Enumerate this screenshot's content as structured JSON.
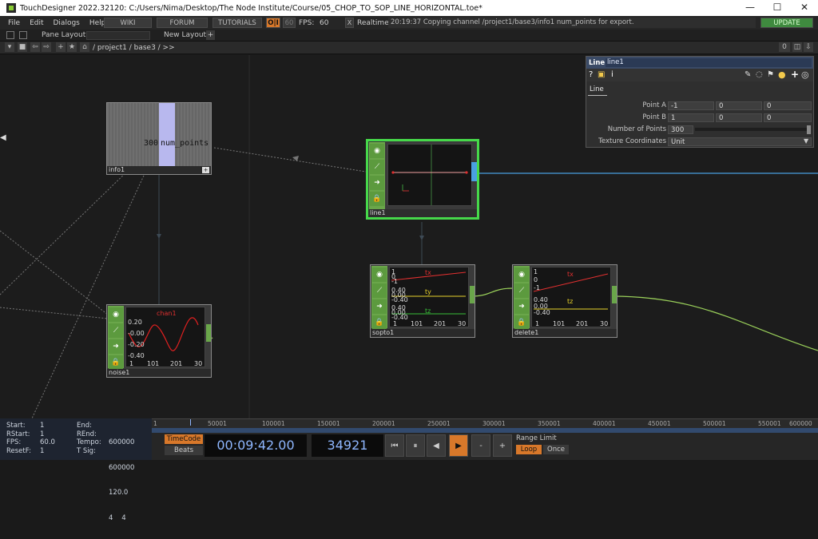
{
  "window": {
    "title": "TouchDesigner 2022.32120: C:/Users/Nima/Desktop/The Node Institute/Course/05_CHOP_TO_SOP_LINE_HORIZONTAL.toe*",
    "minimize": "—",
    "maximize": "☐",
    "close": "✕"
  },
  "menubar": {
    "items": [
      "File",
      "Edit",
      "Dialogs",
      "Help"
    ],
    "wiki": "WIKI",
    "forum": "FORUM",
    "tutorials": "TUTORIALS",
    "perf_badge": "O|I",
    "fps_value_box": "60",
    "fps_label": "FPS:",
    "fps_value": "60",
    "realtime_check": "X",
    "realtime_label": "Realtime",
    "status": "20:19:37 Copying channel /project1/base3/info1 num_points for export.",
    "update": "UPDATE"
  },
  "panebar": {
    "pane_layout": "Pane Layout",
    "new_layout": "New Layout",
    "new_layout_plus": "+"
  },
  "pathbar": {
    "path": "/ project1 / base3 / >>",
    "pane_index": "0"
  },
  "nodes": {
    "info1": {
      "label": "info1",
      "value": "300",
      "channel": "num_points"
    },
    "line1": {
      "label": "line1"
    },
    "noise1": {
      "label": "noise1",
      "channel": "chan1",
      "y_ticks": [
        "0.20",
        "-0.00",
        "-0.20",
        "-0.40"
      ],
      "x_ticks": [
        "1",
        "101",
        "201",
        "30"
      ]
    },
    "sopto1": {
      "label": "sopto1",
      "channels": [
        "tx",
        "ty",
        "tz"
      ],
      "ticks_a": [
        "1",
        "0",
        "-1"
      ],
      "ticks_b": [
        "0.40",
        "0.00",
        "-0.40"
      ],
      "ticks_c": [
        "0.40",
        "0.00",
        "-0.40"
      ],
      "x_ticks": [
        "1",
        "101",
        "201",
        "30"
      ]
    },
    "delete1": {
      "label": "delete1",
      "channels": [
        "tx",
        "tz"
      ],
      "ticks_a": [
        "1",
        "0",
        "-1"
      ],
      "ticks_b": [
        "0.40",
        "0.00",
        "-0.40"
      ],
      "x_ticks": [
        "1",
        "101",
        "201",
        "30"
      ]
    }
  },
  "params": {
    "op_type": "Line",
    "op_name": "line1",
    "tab": "Line",
    "rows": [
      {
        "label": "Point A",
        "values": [
          "-1",
          "0",
          "0"
        ]
      },
      {
        "label": "Point B",
        "values": [
          "1",
          "0",
          "0"
        ]
      },
      {
        "label": "Number of Points",
        "values": [
          "300"
        ]
      },
      {
        "label": "Texture Coordinates",
        "values": [
          "Unit"
        ]
      }
    ]
  },
  "timeline": {
    "ticks": [
      "1",
      "50001",
      "100001",
      "150001",
      "200001",
      "250001",
      "300001",
      "350001",
      "400001",
      "450001",
      "500001",
      "550001",
      "600000"
    ]
  },
  "stats": {
    "left": [
      {
        "k": "Start:",
        "v": "1"
      },
      {
        "k": "RStart:",
        "v": "1"
      },
      {
        "k": "FPS:",
        "v": "60.0"
      },
      {
        "k": "ResetF:",
        "v": "1"
      }
    ],
    "right": [
      {
        "k": "End:",
        "v": "600000"
      },
      {
        "k": "REnd:",
        "v": "600000"
      },
      {
        "k": "Tempo:",
        "v": "120.0"
      },
      {
        "k": "T Sig:",
        "v": "4    4"
      }
    ]
  },
  "controls": {
    "timecode": "TimeCode",
    "beats": "Beats",
    "time": "00:09:42.00",
    "frame": "34921",
    "range_limit": "Range Limit",
    "loop": "Loop",
    "once": "Once",
    "rewind": "⏮",
    "pause": "⏸",
    "step_back": "◀",
    "play": "▶",
    "minus": "-",
    "plus": "+"
  },
  "colors": {
    "accent_green": "#88cc33",
    "selected_node_border": "#46d84a",
    "wire_blue": "#4aa0e0",
    "wire_green": "#9ad05a",
    "time_blue": "#8fb7ff",
    "play_orange": "#d8782a"
  }
}
